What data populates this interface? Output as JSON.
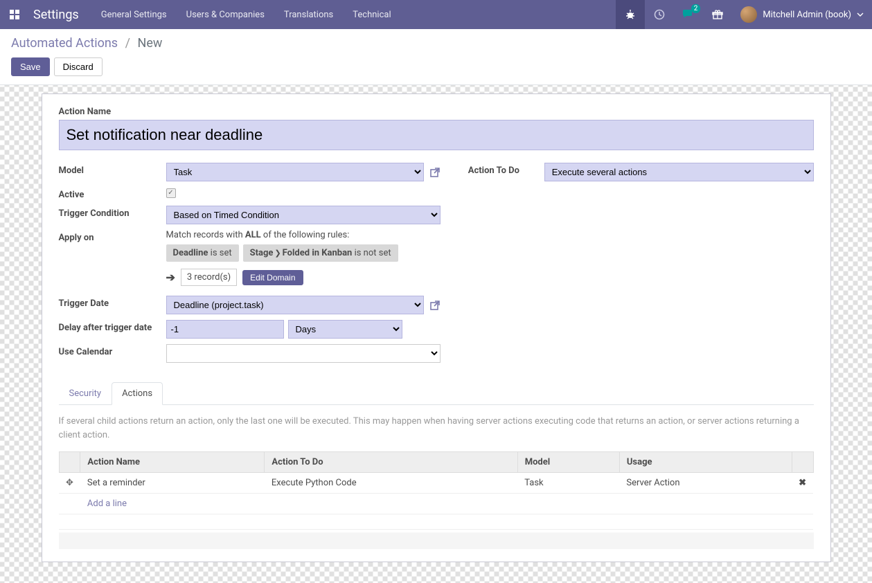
{
  "nav": {
    "title": "Settings",
    "menu": [
      "General Settings",
      "Users & Companies",
      "Translations",
      "Technical"
    ],
    "messaging_badge": "2",
    "user": "Mitchell Admin (book)"
  },
  "breadcrumb": {
    "parent": "Automated Actions",
    "current": "New"
  },
  "buttons": {
    "save": "Save",
    "discard": "Discard",
    "edit_domain": "Edit Domain"
  },
  "labels": {
    "action_name": "Action Name",
    "model": "Model",
    "active": "Active",
    "trigger_condition": "Trigger Condition",
    "apply_on": "Apply on",
    "action_to_do": "Action To Do",
    "trigger_date": "Trigger Date",
    "delay_after": "Delay after trigger date",
    "use_calendar": "Use Calendar"
  },
  "fields": {
    "action_name": "Set notification near deadline",
    "model": "Task",
    "trigger_condition": "Based on Timed Condition",
    "action_to_do": "Execute several actions",
    "trigger_date": "Deadline (project.task)",
    "delay_value": "-1",
    "delay_unit": "Days",
    "use_calendar": ""
  },
  "domain": {
    "match_prefix": "Match records with ",
    "match_all": "ALL",
    "match_suffix": " of the following rules:",
    "chip1_field": "Deadline",
    "chip1_op": " is set",
    "chip2_field1": "Stage",
    "chip2_field2": "Folded in Kanban",
    "chip2_op": " is not set",
    "record_count": "3 record(s)"
  },
  "tabs": {
    "security": "Security",
    "actions": "Actions"
  },
  "actions_tab": {
    "hint": "If several child actions return an action, only the last one will be executed. This may happen when having server actions executing code that returns an action, or server actions returning a client action.",
    "columns": {
      "name": "Action Name",
      "todo": "Action To Do",
      "model": "Model",
      "usage": "Usage"
    },
    "rows": [
      {
        "name": "Set a reminder",
        "todo": "Execute Python Code",
        "model": "Task",
        "usage": "Server Action"
      }
    ],
    "add_line": "Add a line"
  }
}
